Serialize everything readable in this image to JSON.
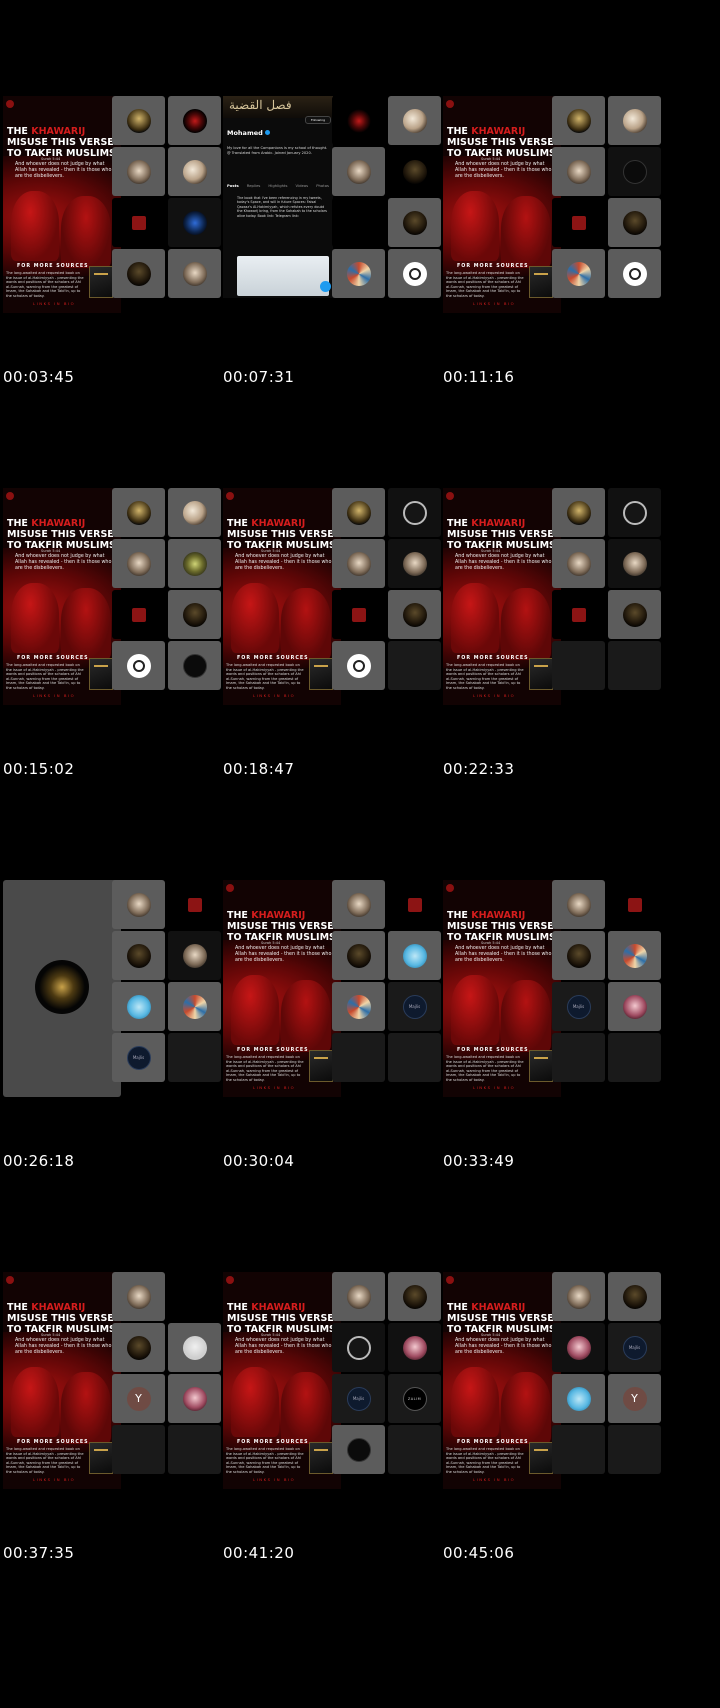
{
  "poster": {
    "headline_pre": "THE",
    "headline_red": "KHAWARIJ",
    "headline_post": "MISUSE THIS VERSE TO TAKFIR MUSLIMS",
    "verse_ref": "Surah 5:44",
    "verse_text": "And whoever does not judge by what Allah has revealed - then it is those who are the disbelievers.",
    "sources_title": "FOR MORE SOURCES",
    "sources_text": "The long-awaited and requested book on the issue of al-Hakimiyyah - presenting the words and positions of the scholars of Ahl al-Sunnah, warning from the greatest of Imam, the Sahabah and the Tabi'in, up to the scholars of today.",
    "link_text": "LINKS IN BIO"
  },
  "twitter": {
    "banner_text": "فصل القضية",
    "follow_label": "Following",
    "name": "Mohamed",
    "bio": "My love for all the Companions is my school of thought. @ Translated from Arabic. Joined January 2020.",
    "tabs": [
      "Posts",
      "Replies",
      "Highlights",
      "Videos",
      "Photos"
    ],
    "tweet": "The book that I've been referencing in my tweets, today's Space, and will in future Spaces: Faisal Qazzaz's Al-Hakimiyyah, which refutes every doubt the Khawarij bring, from the Sahabah to the scholars alive today. Book link: Telegram link:"
  },
  "frames": [
    {
      "time": "00:03:45"
    },
    {
      "time": "00:07:31"
    },
    {
      "time": "00:11:16"
    },
    {
      "time": "00:15:02"
    },
    {
      "time": "00:18:47"
    },
    {
      "time": "00:22:33"
    },
    {
      "time": "00:26:18"
    },
    {
      "time": "00:30:04"
    },
    {
      "time": "00:33:49"
    },
    {
      "time": "00:37:35"
    },
    {
      "time": "00:41:20"
    },
    {
      "time": "00:45:06"
    }
  ]
}
